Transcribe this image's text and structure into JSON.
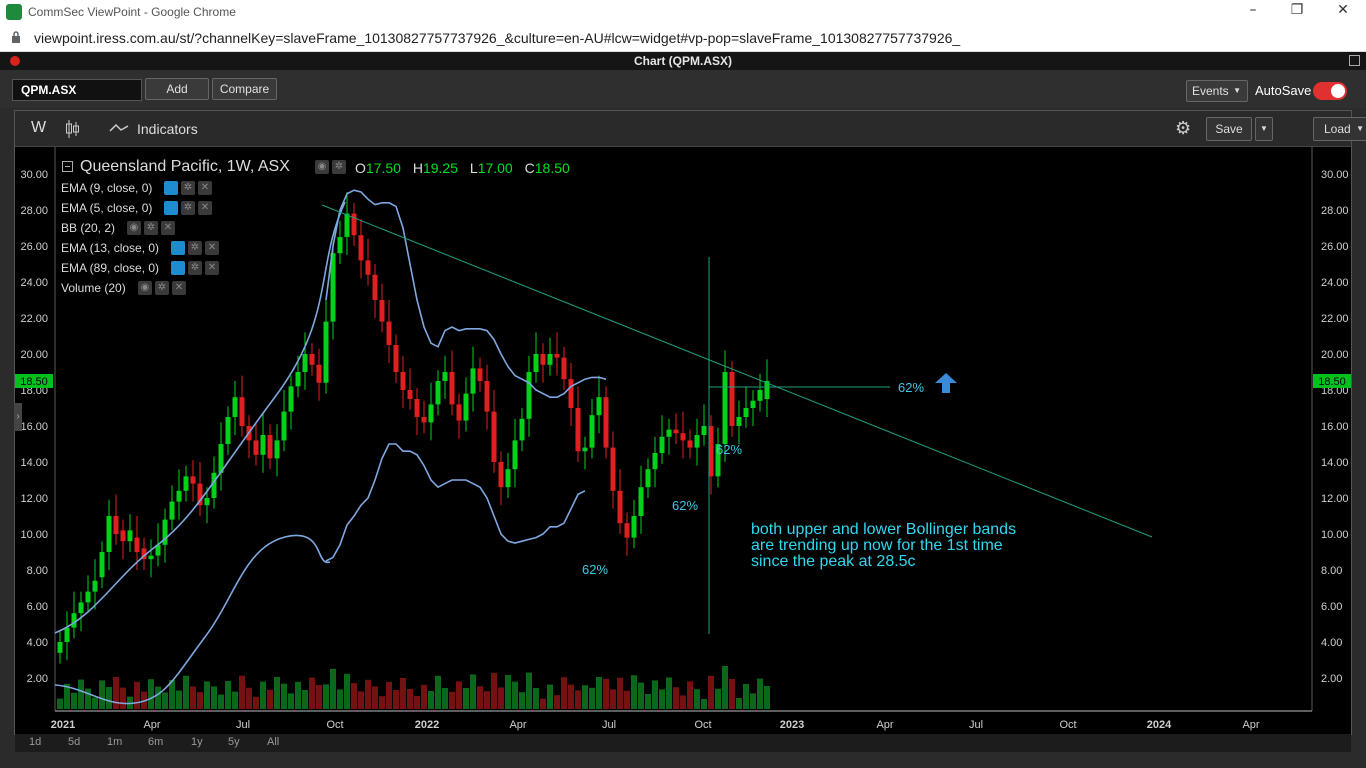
{
  "browser": {
    "window_title": "CommSec ViewPoint - Google Chrome",
    "url": "viewpoint.iress.com.au/st/?channelKey=slaveFrame_10130827757737926_&culture=en-AU#lcw=widget#vp-pop=slaveFrame_10130827757737926_",
    "controls": [
      "–",
      "❐",
      "✕"
    ]
  },
  "panel": {
    "title": "Chart (QPM.ASX)"
  },
  "toolbar": {
    "symbol": "QPM.ASX",
    "add_label": "Add",
    "compare_label": "Compare",
    "events_label": "Events",
    "autosave_label": "AutoSave",
    "autosave_on": true
  },
  "chart_toolbar": {
    "interval": "W",
    "indicators_label": "Indicators",
    "save_label": "Save",
    "load_label": "Load"
  },
  "header": {
    "title": "Queensland Pacific, 1W, ASX",
    "open_label": "O",
    "open": "17.50",
    "high_label": "H",
    "high": "19.25",
    "low_label": "L",
    "low": "17.00",
    "close_label": "C",
    "close": "18.50"
  },
  "studies": [
    {
      "label": "EMA (9, close, 0)",
      "visible": true
    },
    {
      "label": "EMA (5, close, 0)",
      "visible": true
    },
    {
      "label": "BB (20, 2)",
      "visible": false
    },
    {
      "label": "EMA (13, close, 0)",
      "visible": true
    },
    {
      "label": "EMA (89, close, 0)",
      "visible": true
    },
    {
      "label": "Volume (20)",
      "visible": false
    }
  ],
  "periods": [
    "1d",
    "5d",
    "1m",
    "6m",
    "1y",
    "5y",
    "All"
  ],
  "annotations": {
    "retrace_1": "62%",
    "retrace_2": "62%",
    "retrace_3": "62%",
    "retrace_4": "62%",
    "note": [
      "both upper and lower Bollinger bands",
      "are trending up now for the 1st time",
      "since the peak at 28.5c"
    ]
  },
  "colors": {
    "up": "#00d21a",
    "down": "#e02020",
    "band": "#7fa8e0",
    "trend": "#1fa080",
    "note": "#30d8f0",
    "arrow": "#3a8ad8"
  },
  "chart_data": {
    "type": "candlestick",
    "y_ticks": [
      "30.00",
      "28.00",
      "26.00",
      "24.00",
      "22.00",
      "20.00",
      "18.00",
      "16.00",
      "14.00",
      "12.00",
      "10.00",
      "8.00",
      "6.00",
      "4.00",
      "2.00"
    ],
    "ylim": [
      0.6,
      31
    ],
    "last_price": "18.50",
    "x_ticks": [
      "2021",
      "Apr",
      "Jul",
      "Oct",
      "2022",
      "Apr",
      "Jul",
      "Oct",
      "2023",
      "Apr",
      "Jul",
      "Oct",
      "2024",
      "Apr"
    ],
    "closes": [
      4.0,
      4.8,
      5.6,
      6.2,
      6.8,
      7.4,
      9.0,
      11.0,
      10.0,
      9.6,
      10.2,
      9.0,
      8.6,
      8.8,
      9.4,
      10.8,
      11.8,
      12.4,
      13.2,
      12.8,
      11.6,
      12.0,
      13.4,
      15.0,
      16.5,
      17.6,
      16.0,
      15.2,
      14.4,
      15.5,
      14.2,
      15.2,
      16.8,
      18.2,
      19.0,
      20.0,
      19.4,
      18.4,
      21.8,
      25.6,
      26.5,
      27.8,
      26.6,
      25.2,
      24.4,
      23.0,
      21.8,
      20.5,
      19.0,
      18.0,
      17.5,
      16.5,
      16.2,
      17.2,
      18.5,
      19.0,
      17.2,
      16.3,
      17.8,
      19.2,
      18.5,
      16.8,
      14.0,
      12.6,
      13.6,
      15.2,
      16.4,
      19.0,
      20.0,
      19.4,
      20.0,
      19.8,
      18.6,
      17.0,
      14.6,
      14.8,
      16.6,
      17.6,
      14.8,
      12.4,
      10.6,
      9.8,
      11.0,
      12.6,
      13.6,
      14.5,
      15.4,
      15.8,
      15.6,
      15.2,
      14.8,
      15.5,
      16.0,
      13.2,
      15.0,
      19.0,
      16.0,
      16.5,
      17.0,
      17.4,
      18.0,
      18.5
    ],
    "opens": [
      3.4,
      4.0,
      4.8,
      5.6,
      6.2,
      6.8,
      7.6,
      9.0,
      11.0,
      10.2,
      9.6,
      9.8,
      9.2,
      8.6,
      8.8,
      9.4,
      10.8,
      11.8,
      12.4,
      13.2,
      12.8,
      11.6,
      12.0,
      13.4,
      15.0,
      16.5,
      17.6,
      16.0,
      15.2,
      14.4,
      15.5,
      14.2,
      15.2,
      16.8,
      18.2,
      19.0,
      20.0,
      19.4,
      18.4,
      21.8,
      25.6,
      26.5,
      27.8,
      26.6,
      25.2,
      24.4,
      23.0,
      21.8,
      20.5,
      19.0,
      18.0,
      17.5,
      16.5,
      16.2,
      17.2,
      18.5,
      19.0,
      17.2,
      16.3,
      17.8,
      19.2,
      18.5,
      16.8,
      14.0,
      12.6,
      13.6,
      15.2,
      16.4,
      19.0,
      20.0,
      19.4,
      20.0,
      19.8,
      18.6,
      17.0,
      14.6,
      14.8,
      16.6,
      17.6,
      14.8,
      12.4,
      10.6,
      9.8,
      11.0,
      12.6,
      13.6,
      14.5,
      15.4,
      15.8,
      15.6,
      15.2,
      14.8,
      15.5,
      16.0,
      13.2,
      15.0,
      19.0,
      16.0,
      16.5,
      17.0,
      17.4,
      17.5
    ],
    "volume_scale_note": "Volume bars at bottom, unlabelled",
    "upper_band": [
      null,
      null,
      null,
      null,
      null,
      null,
      null,
      null,
      null,
      null,
      null,
      null,
      null,
      null,
      null,
      null,
      null,
      null,
      null,
      null,
      null,
      null,
      null,
      null,
      null,
      null,
      null,
      null,
      null,
      null,
      null,
      null,
      null,
      null,
      null,
      null,
      null,
      null,
      23.0,
      26.0,
      28.0,
      28.9,
      29.1,
      29.0,
      28.6,
      28.3,
      28.4,
      28.4,
      28.2,
      27.0,
      25.0,
      23.0,
      21.5,
      20.6,
      20.4,
      21.3,
      21.5,
      21.3,
      21.4,
      21.4,
      21.4,
      21.3,
      20.8,
      20.0,
      19.3,
      18.8,
      18.6,
      18.4,
      18.0,
      17.8,
      17.6,
      17.6,
      17.8,
      18.2,
      18.4,
      18.6,
      18.7,
      18.7,
      18.6
    ],
    "lower_band": [
      null,
      null,
      null,
      null,
      null,
      null,
      null,
      null,
      null,
      null,
      null,
      null,
      null,
      null,
      null,
      null,
      null,
      null,
      null,
      null,
      null,
      null,
      null,
      null,
      null,
      null,
      null,
      null,
      null,
      null,
      null,
      null,
      null,
      null,
      null,
      null,
      null,
      null,
      8.5,
      8.7,
      9.4,
      10.5,
      11.0,
      11.6,
      12.0,
      13.0,
      14.2,
      15.0,
      15.0,
      14.6,
      14.6,
      14.4,
      13.8,
      13.0,
      12.6,
      12.8,
      13.0,
      13.0,
      13.0,
      12.8,
      12.6,
      12.0,
      11.0,
      10.0,
      9.6,
      9.5,
      9.6,
      9.7,
      9.8,
      10.0,
      10.4,
      10.4,
      10.6,
      11.4,
      12.2,
      12.4
    ]
  }
}
